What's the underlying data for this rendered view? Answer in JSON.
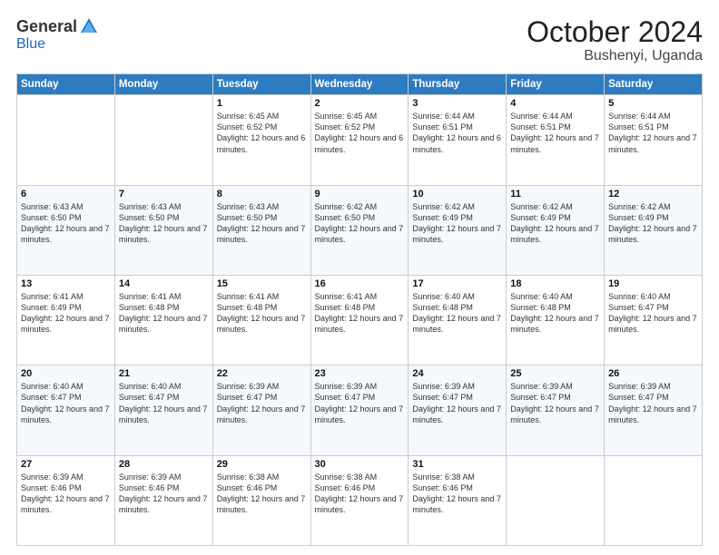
{
  "logo": {
    "general": "General",
    "blue": "Blue"
  },
  "header": {
    "month": "October 2024",
    "location": "Bushenyi, Uganda"
  },
  "weekdays": [
    "Sunday",
    "Monday",
    "Tuesday",
    "Wednesday",
    "Thursday",
    "Friday",
    "Saturday"
  ],
  "weeks": [
    [
      {
        "day": "",
        "sunrise": "",
        "sunset": "",
        "daylight": ""
      },
      {
        "day": "",
        "sunrise": "",
        "sunset": "",
        "daylight": ""
      },
      {
        "day": "1",
        "sunrise": "Sunrise: 6:45 AM",
        "sunset": "Sunset: 6:52 PM",
        "daylight": "Daylight: 12 hours and 6 minutes."
      },
      {
        "day": "2",
        "sunrise": "Sunrise: 6:45 AM",
        "sunset": "Sunset: 6:52 PM",
        "daylight": "Daylight: 12 hours and 6 minutes."
      },
      {
        "day": "3",
        "sunrise": "Sunrise: 6:44 AM",
        "sunset": "Sunset: 6:51 PM",
        "daylight": "Daylight: 12 hours and 6 minutes."
      },
      {
        "day": "4",
        "sunrise": "Sunrise: 6:44 AM",
        "sunset": "Sunset: 6:51 PM",
        "daylight": "Daylight: 12 hours and 7 minutes."
      },
      {
        "day": "5",
        "sunrise": "Sunrise: 6:44 AM",
        "sunset": "Sunset: 6:51 PM",
        "daylight": "Daylight: 12 hours and 7 minutes."
      }
    ],
    [
      {
        "day": "6",
        "sunrise": "Sunrise: 6:43 AM",
        "sunset": "Sunset: 6:50 PM",
        "daylight": "Daylight: 12 hours and 7 minutes."
      },
      {
        "day": "7",
        "sunrise": "Sunrise: 6:43 AM",
        "sunset": "Sunset: 6:50 PM",
        "daylight": "Daylight: 12 hours and 7 minutes."
      },
      {
        "day": "8",
        "sunrise": "Sunrise: 6:43 AM",
        "sunset": "Sunset: 6:50 PM",
        "daylight": "Daylight: 12 hours and 7 minutes."
      },
      {
        "day": "9",
        "sunrise": "Sunrise: 6:42 AM",
        "sunset": "Sunset: 6:50 PM",
        "daylight": "Daylight: 12 hours and 7 minutes."
      },
      {
        "day": "10",
        "sunrise": "Sunrise: 6:42 AM",
        "sunset": "Sunset: 6:49 PM",
        "daylight": "Daylight: 12 hours and 7 minutes."
      },
      {
        "day": "11",
        "sunrise": "Sunrise: 6:42 AM",
        "sunset": "Sunset: 6:49 PM",
        "daylight": "Daylight: 12 hours and 7 minutes."
      },
      {
        "day": "12",
        "sunrise": "Sunrise: 6:42 AM",
        "sunset": "Sunset: 6:49 PM",
        "daylight": "Daylight: 12 hours and 7 minutes."
      }
    ],
    [
      {
        "day": "13",
        "sunrise": "Sunrise: 6:41 AM",
        "sunset": "Sunset: 6:49 PM",
        "daylight": "Daylight: 12 hours and 7 minutes."
      },
      {
        "day": "14",
        "sunrise": "Sunrise: 6:41 AM",
        "sunset": "Sunset: 6:48 PM",
        "daylight": "Daylight: 12 hours and 7 minutes."
      },
      {
        "day": "15",
        "sunrise": "Sunrise: 6:41 AM",
        "sunset": "Sunset: 6:48 PM",
        "daylight": "Daylight: 12 hours and 7 minutes."
      },
      {
        "day": "16",
        "sunrise": "Sunrise: 6:41 AM",
        "sunset": "Sunset: 6:48 PM",
        "daylight": "Daylight: 12 hours and 7 minutes."
      },
      {
        "day": "17",
        "sunrise": "Sunrise: 6:40 AM",
        "sunset": "Sunset: 6:48 PM",
        "daylight": "Daylight: 12 hours and 7 minutes."
      },
      {
        "day": "18",
        "sunrise": "Sunrise: 6:40 AM",
        "sunset": "Sunset: 6:48 PM",
        "daylight": "Daylight: 12 hours and 7 minutes."
      },
      {
        "day": "19",
        "sunrise": "Sunrise: 6:40 AM",
        "sunset": "Sunset: 6:47 PM",
        "daylight": "Daylight: 12 hours and 7 minutes."
      }
    ],
    [
      {
        "day": "20",
        "sunrise": "Sunrise: 6:40 AM",
        "sunset": "Sunset: 6:47 PM",
        "daylight": "Daylight: 12 hours and 7 minutes."
      },
      {
        "day": "21",
        "sunrise": "Sunrise: 6:40 AM",
        "sunset": "Sunset: 6:47 PM",
        "daylight": "Daylight: 12 hours and 7 minutes."
      },
      {
        "day": "22",
        "sunrise": "Sunrise: 6:39 AM",
        "sunset": "Sunset: 6:47 PM",
        "daylight": "Daylight: 12 hours and 7 minutes."
      },
      {
        "day": "23",
        "sunrise": "Sunrise: 6:39 AM",
        "sunset": "Sunset: 6:47 PM",
        "daylight": "Daylight: 12 hours and 7 minutes."
      },
      {
        "day": "24",
        "sunrise": "Sunrise: 6:39 AM",
        "sunset": "Sunset: 6:47 PM",
        "daylight": "Daylight: 12 hours and 7 minutes."
      },
      {
        "day": "25",
        "sunrise": "Sunrise: 6:39 AM",
        "sunset": "Sunset: 6:47 PM",
        "daylight": "Daylight: 12 hours and 7 minutes."
      },
      {
        "day": "26",
        "sunrise": "Sunrise: 6:39 AM",
        "sunset": "Sunset: 6:47 PM",
        "daylight": "Daylight: 12 hours and 7 minutes."
      }
    ],
    [
      {
        "day": "27",
        "sunrise": "Sunrise: 6:39 AM",
        "sunset": "Sunset: 6:46 PM",
        "daylight": "Daylight: 12 hours and 7 minutes."
      },
      {
        "day": "28",
        "sunrise": "Sunrise: 6:39 AM",
        "sunset": "Sunset: 6:46 PM",
        "daylight": "Daylight: 12 hours and 7 minutes."
      },
      {
        "day": "29",
        "sunrise": "Sunrise: 6:38 AM",
        "sunset": "Sunset: 6:46 PM",
        "daylight": "Daylight: 12 hours and 7 minutes."
      },
      {
        "day": "30",
        "sunrise": "Sunrise: 6:38 AM",
        "sunset": "Sunset: 6:46 PM",
        "daylight": "Daylight: 12 hours and 7 minutes."
      },
      {
        "day": "31",
        "sunrise": "Sunrise: 6:38 AM",
        "sunset": "Sunset: 6:46 PM",
        "daylight": "Daylight: 12 hours and 7 minutes."
      },
      {
        "day": "",
        "sunrise": "",
        "sunset": "",
        "daylight": ""
      },
      {
        "day": "",
        "sunrise": "",
        "sunset": "",
        "daylight": ""
      }
    ]
  ]
}
